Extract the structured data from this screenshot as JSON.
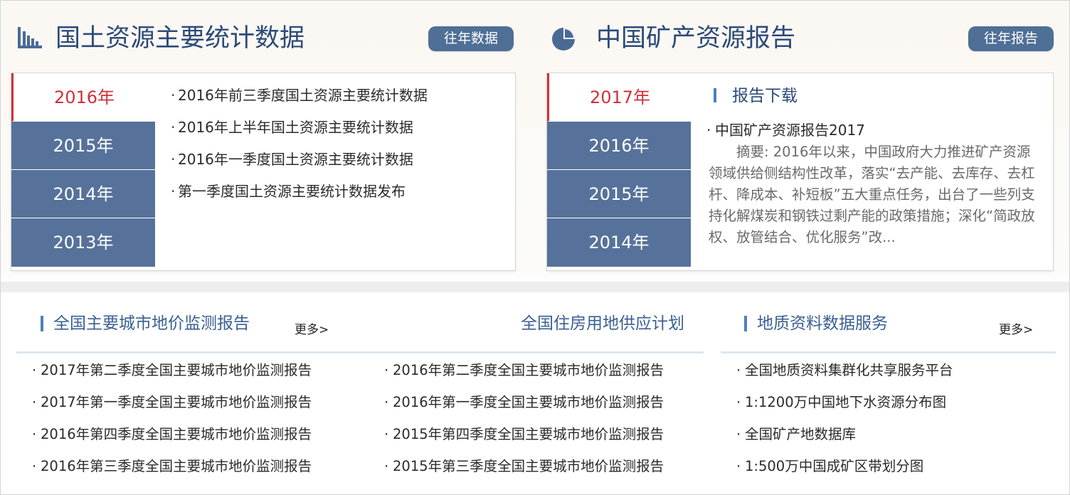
{
  "left_section": {
    "title": "国土资源主要统计数据",
    "icon": "bar-chart-icon",
    "button_label": "往年数据",
    "years": [
      "2016年",
      "2015年",
      "2014年",
      "2013年"
    ],
    "items": [
      "2016年前三季度国土资源主要统计数据",
      "2016年上半年国土资源主要统计数据",
      "2016年一季度国土资源主要统计数据",
      "第一季度国土资源主要统计数据发布"
    ]
  },
  "right_section": {
    "title": "中国矿产资源报告",
    "icon": "pie-chart-icon",
    "button_label": "往年报告",
    "years": [
      "2017年",
      "2016年",
      "2015年",
      "2014年"
    ],
    "subtitle": "报告下载",
    "report_link": "中国矿产资源报告2017",
    "abstract": "摘要: 2016年以来，中国政府大力推进矿产资源领域供给侧结构性改革，落实“去产能、去库存、去杠杆、降成本、补短板”五大重点任务，出台了一些列支持化解煤炭和钢铁过剩产能的政策措施；深化“简政放权、放管结合、优化服务”改..."
  },
  "bottom_left": {
    "title": "全国主要城市地价监测报告",
    "more_label": "更多>",
    "alt_title": "全国住房用地供应计划",
    "col1": [
      "2017年第二季度全国主要城市地价监测报告",
      "2017年第一季度全国主要城市地价监测报告",
      "2016年第四季度全国主要城市地价监测报告",
      "2016年第三季度全国主要城市地价监测报告"
    ],
    "col2": [
      "2016年第二季度全国主要城市地价监测报告",
      "2016年第一季度全国主要城市地价监测报告",
      "2015年第四季度全国主要城市地价监测报告",
      "2015年第三季度全国主要城市地价监测报告"
    ]
  },
  "bottom_right": {
    "title": "地质资料数据服务",
    "more_label": "更多>",
    "items": [
      "全国地质资料集群化共享服务平台",
      "1:1200万中国地下水资源分布图",
      "全国矿产地数据库",
      "1:500万中国成矿区带划分图"
    ]
  },
  "colors": {
    "title_blue": "#2c4a78",
    "tab_blue": "#56729a",
    "active_red": "#d1303b",
    "button_blue": "#4f6f96"
  }
}
